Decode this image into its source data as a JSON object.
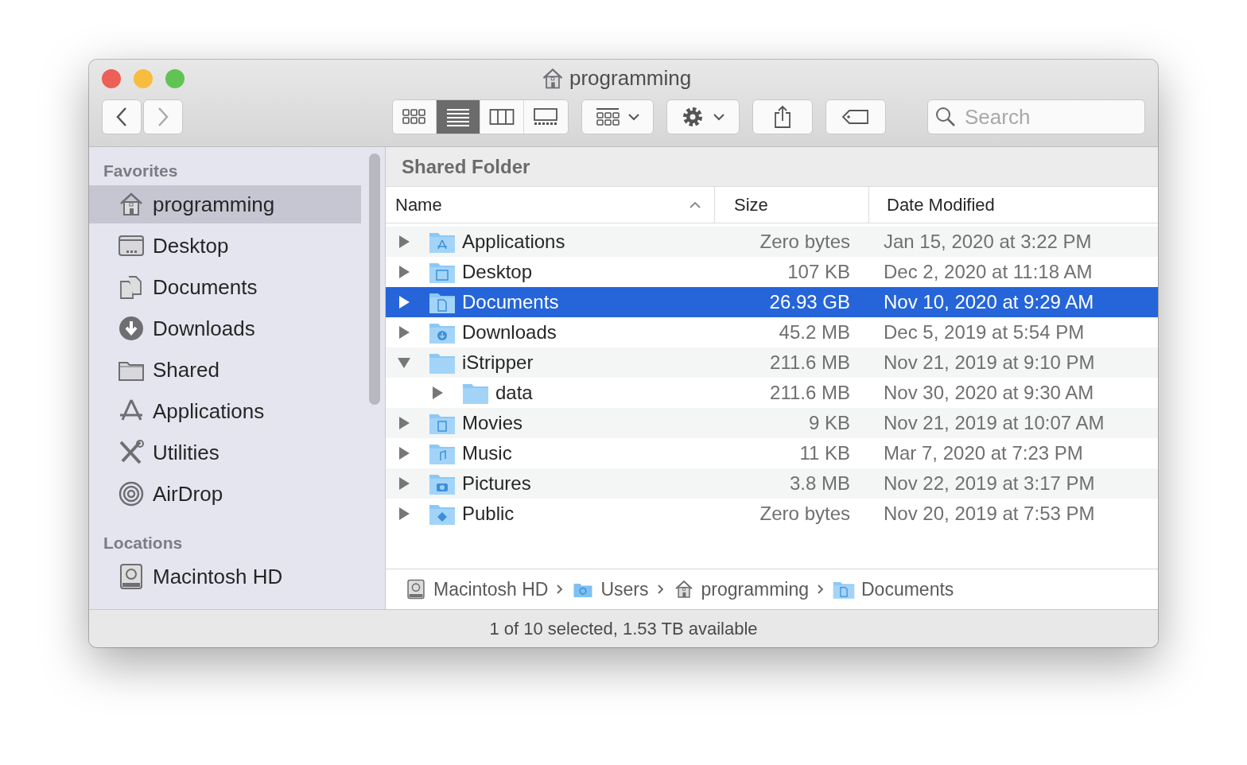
{
  "window": {
    "title": "programming"
  },
  "toolbar": {
    "views": [
      {
        "kind": "icons",
        "selected": false
      },
      {
        "kind": "list",
        "selected": true
      },
      {
        "kind": "columns",
        "selected": false
      },
      {
        "kind": "gallery",
        "selected": false
      }
    ],
    "search": {
      "placeholder": "Search"
    }
  },
  "sidebar": {
    "sections": [
      {
        "title": "Favorites",
        "items": [
          {
            "label": "programming",
            "kind": "home",
            "selected": true
          },
          {
            "label": "Desktop",
            "kind": "desktop",
            "selected": false
          },
          {
            "label": "Documents",
            "kind": "documents",
            "selected": false
          },
          {
            "label": "Downloads",
            "kind": "downloads",
            "selected": false
          },
          {
            "label": "Shared",
            "kind": "folder",
            "selected": false
          },
          {
            "label": "Applications",
            "kind": "apps",
            "selected": false
          },
          {
            "label": "Utilities",
            "kind": "tools",
            "selected": false
          },
          {
            "label": "AirDrop",
            "kind": "airdrop",
            "selected": false
          }
        ]
      },
      {
        "title": "Locations",
        "items": [
          {
            "label": "Macintosh HD",
            "kind": "disk",
            "selected": false
          }
        ]
      }
    ]
  },
  "header": "Shared Folder",
  "table": {
    "columns": [
      "Name",
      "Size",
      "Date Modified"
    ],
    "rows": [
      {
        "name": "Applications",
        "kind": "apps",
        "size": "Zero bytes",
        "date": "Jan 15, 2020 at 3:22 PM",
        "expanded": false,
        "selected": false
      },
      {
        "name": "Desktop",
        "kind": "desktop",
        "size": "107 KB",
        "date": "Dec 2, 2020 at 11:18 AM",
        "expanded": false,
        "selected": false
      },
      {
        "name": "Documents",
        "kind": "documents",
        "size": "26.93 GB",
        "date": "Nov 10, 2020 at 9:29 AM",
        "expanded": false,
        "selected": true
      },
      {
        "name": "Downloads",
        "kind": "downloads",
        "size": "45.2 MB",
        "date": "Dec 5, 2019 at 5:54 PM",
        "expanded": false,
        "selected": false
      },
      {
        "name": "iStripper",
        "kind": "folder",
        "size": "211.6 MB",
        "date": "Nov 21, 2019 at 9:10 PM",
        "expanded": true,
        "selected": false,
        "children": [
          {
            "name": "data",
            "kind": "folder",
            "size": "211.6 MB",
            "date": "Nov 30, 2020 at 9:30 AM",
            "expanded": false,
            "selected": false
          }
        ]
      },
      {
        "name": "Movies",
        "kind": "movies",
        "size": "9 KB",
        "date": "Nov 21, 2019 at 10:07 AM",
        "expanded": false,
        "selected": false
      },
      {
        "name": "Music",
        "kind": "music",
        "size": "11 KB",
        "date": "Mar 7, 2020 at 7:23 PM",
        "expanded": false,
        "selected": false
      },
      {
        "name": "Pictures",
        "kind": "pictures",
        "size": "3.8 MB",
        "date": "Nov 22, 2019 at 3:17 PM",
        "expanded": false,
        "selected": false
      },
      {
        "name": "Public",
        "kind": "public",
        "size": "Zero bytes",
        "date": "Nov 20, 2019 at 7:53 PM",
        "expanded": false,
        "selected": false
      }
    ]
  },
  "path_bar": [
    {
      "label": "Macintosh HD",
      "kind": "disk"
    },
    {
      "label": "Users",
      "kind": "users"
    },
    {
      "label": "programming",
      "kind": "home"
    },
    {
      "label": "Documents",
      "kind": "documents"
    }
  ],
  "status_bar": "1 of 10 selected, 1.53 TB available"
}
